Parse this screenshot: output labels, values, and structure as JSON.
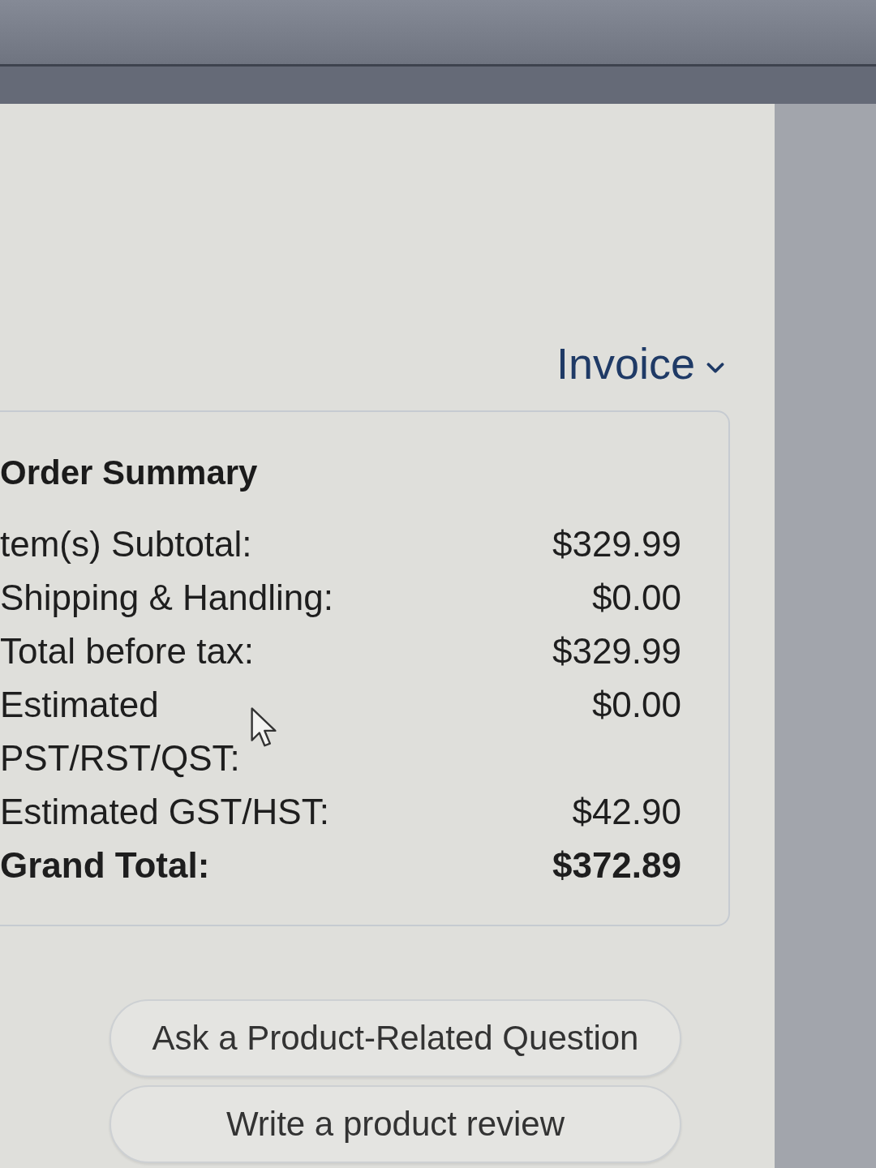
{
  "invoice_link": {
    "label": "Invoice"
  },
  "order_summary": {
    "title": "Order Summary",
    "rows": [
      {
        "kind": "line",
        "label": "tem(s) Subtotal:",
        "value": "$329.99"
      },
      {
        "kind": "line",
        "label": "Shipping & Handling:",
        "value": "$0.00"
      },
      {
        "kind": "line",
        "label": "Total before tax:",
        "value": "$329.99"
      },
      {
        "kind": "line",
        "label": "Estimated PST/RST/QST:",
        "value": "$0.00"
      },
      {
        "kind": "line",
        "label": "Estimated GST/HST:",
        "value": "$42.90"
      },
      {
        "kind": "total",
        "label": "Grand Total:",
        "value": "$372.89"
      }
    ]
  },
  "buttons": [
    "Ask a Product-Related Question",
    "Write a product review"
  ]
}
